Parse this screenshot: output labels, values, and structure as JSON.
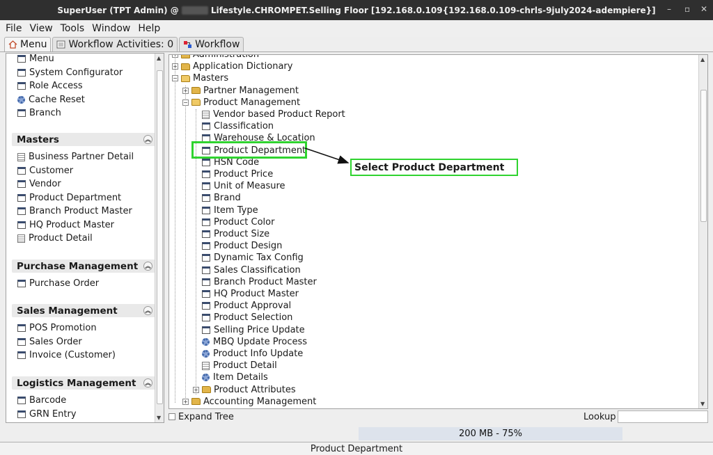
{
  "window": {
    "title_left": "SuperUser (TPT Admin) @",
    "title_right": "Lifestyle.CHROMPET.Selling Floor [192.168.0.109{192.168.0.109-chrls-9july2024-adempiere}]",
    "minimize": "–",
    "maximize": "▫",
    "close": "✕"
  },
  "menubar": {
    "file": "File",
    "view": "View",
    "tools": "Tools",
    "window": "Window",
    "help": "Help"
  },
  "tabs": [
    {
      "label": "Menu"
    },
    {
      "label": "Workflow Activities: 0"
    },
    {
      "label": "Workflow"
    }
  ],
  "left_panel": {
    "top_items": [
      {
        "label": "Menu",
        "icon": "window"
      },
      {
        "label": "System Configurator",
        "icon": "window"
      },
      {
        "label": "Role Access",
        "icon": "window"
      },
      {
        "label": "Cache Reset",
        "icon": "gear"
      },
      {
        "label": "Branch",
        "icon": "window"
      }
    ],
    "sections": [
      {
        "title": "Masters",
        "items": [
          {
            "label": "Business Partner Detail",
            "icon": "report"
          },
          {
            "label": "Customer",
            "icon": "window"
          },
          {
            "label": "Vendor",
            "icon": "window"
          },
          {
            "label": "Product Department",
            "icon": "window"
          },
          {
            "label": "Branch Product Master",
            "icon": "window"
          },
          {
            "label": "HQ Product Master",
            "icon": "window"
          },
          {
            "label": "Product Detail",
            "icon": "report"
          }
        ]
      },
      {
        "title": "Purchase Management",
        "items": [
          {
            "label": "Purchase Order",
            "icon": "window"
          }
        ]
      },
      {
        "title": "Sales Management",
        "items": [
          {
            "label": "POS Promotion",
            "icon": "window"
          },
          {
            "label": "Sales Order",
            "icon": "window"
          },
          {
            "label": "Invoice (Customer)",
            "icon": "window"
          }
        ]
      },
      {
        "title": "Logistics Management",
        "items": [
          {
            "label": "Barcode",
            "icon": "window"
          },
          {
            "label": "GRN Entry",
            "icon": "window"
          }
        ]
      }
    ]
  },
  "tree": {
    "nodes": [
      {
        "label": "Administration",
        "icon": "folder",
        "level": 0,
        "expander": "+"
      },
      {
        "label": "Application Dictionary",
        "icon": "folder",
        "level": 0,
        "expander": "+"
      },
      {
        "label": "Masters",
        "icon": "folder-open",
        "level": 0,
        "expander": "−"
      },
      {
        "label": "Partner Management",
        "icon": "folder",
        "level": 1,
        "expander": "+"
      },
      {
        "label": "Product Management",
        "icon": "folder-open",
        "level": 1,
        "expander": "−"
      },
      {
        "label": "Vendor based Product Report",
        "icon": "report",
        "level": 2
      },
      {
        "label": "Classification",
        "icon": "window",
        "level": 2
      },
      {
        "label": "Warehouse & Location",
        "icon": "window",
        "level": 2
      },
      {
        "label": "Product Department",
        "icon": "window",
        "level": 2
      },
      {
        "label": "HSN Code",
        "icon": "window",
        "level": 2
      },
      {
        "label": "Product Price",
        "icon": "window",
        "level": 2
      },
      {
        "label": "Unit of Measure",
        "icon": "window",
        "level": 2
      },
      {
        "label": "Brand",
        "icon": "window",
        "level": 2
      },
      {
        "label": "Item Type",
        "icon": "window",
        "level": 2
      },
      {
        "label": "Product Color",
        "icon": "window",
        "level": 2
      },
      {
        "label": "Product Size",
        "icon": "window",
        "level": 2
      },
      {
        "label": "Product Design",
        "icon": "window",
        "level": 2
      },
      {
        "label": "Dynamic Tax Config",
        "icon": "window",
        "level": 2
      },
      {
        "label": "Sales Classification",
        "icon": "window",
        "level": 2
      },
      {
        "label": "Branch Product Master",
        "icon": "window",
        "level": 2
      },
      {
        "label": "HQ Product Master",
        "icon": "window",
        "level": 2
      },
      {
        "label": "Product Approval",
        "icon": "window",
        "level": 2
      },
      {
        "label": "Product Selection",
        "icon": "window",
        "level": 2
      },
      {
        "label": "Selling Price Update",
        "icon": "window",
        "level": 2
      },
      {
        "label": "MBQ Update Process",
        "icon": "gear",
        "level": 2
      },
      {
        "label": "Product Info Update",
        "icon": "gear",
        "level": 2
      },
      {
        "label": "Product Detail",
        "icon": "report",
        "level": 2
      },
      {
        "label": "Item Details",
        "icon": "gear",
        "level": 2
      },
      {
        "label": "Product Attributes",
        "icon": "folder",
        "level": 2,
        "expander": "+"
      },
      {
        "label": "Accounting Management",
        "icon": "folder",
        "level": 1,
        "expander": "+"
      }
    ]
  },
  "annotation": {
    "callout": "Select Product Department",
    "highlight_color": "#2fd32f"
  },
  "bottom": {
    "expand_tree": "Expand Tree",
    "lookup": "Lookup",
    "lookup_value": ""
  },
  "memory": "200 MB - 75%",
  "status": "Product Department"
}
